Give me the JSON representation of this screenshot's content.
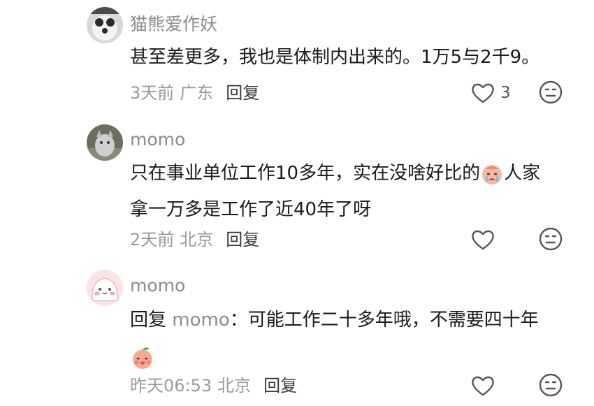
{
  "comments": [
    {
      "username": "猫熊爱作妖",
      "text": "甚至差更多，我也是体制内出来的。1万5与2千9。",
      "time": "3天前",
      "location": "广东",
      "reply_label": "回复",
      "likes": "3",
      "avatar_icon": "panda-photo-avatar"
    },
    {
      "username": "momo",
      "text_part1": "只在事业单位工作10多年，实在没啥好比的",
      "text_part2": "人家",
      "text_line2": "拿一万多是工作了近40年了呀",
      "time": "2天前",
      "location": "北京",
      "reply_label": "回复",
      "likes": "",
      "avatar_icon": "cat-photo-avatar",
      "inline_emoji": "crying-emoji"
    },
    {
      "username": "momo",
      "reply_prefix": "回复",
      "mention": "momo",
      "text": "：可能工作二十多年哦，不需要四十年",
      "time": "昨天06:53",
      "location": "北京",
      "reply_label": "回复",
      "likes": "",
      "avatar_icon": "pink-blob-avatar",
      "inline_emoji": "peach-face-emoji"
    }
  ]
}
